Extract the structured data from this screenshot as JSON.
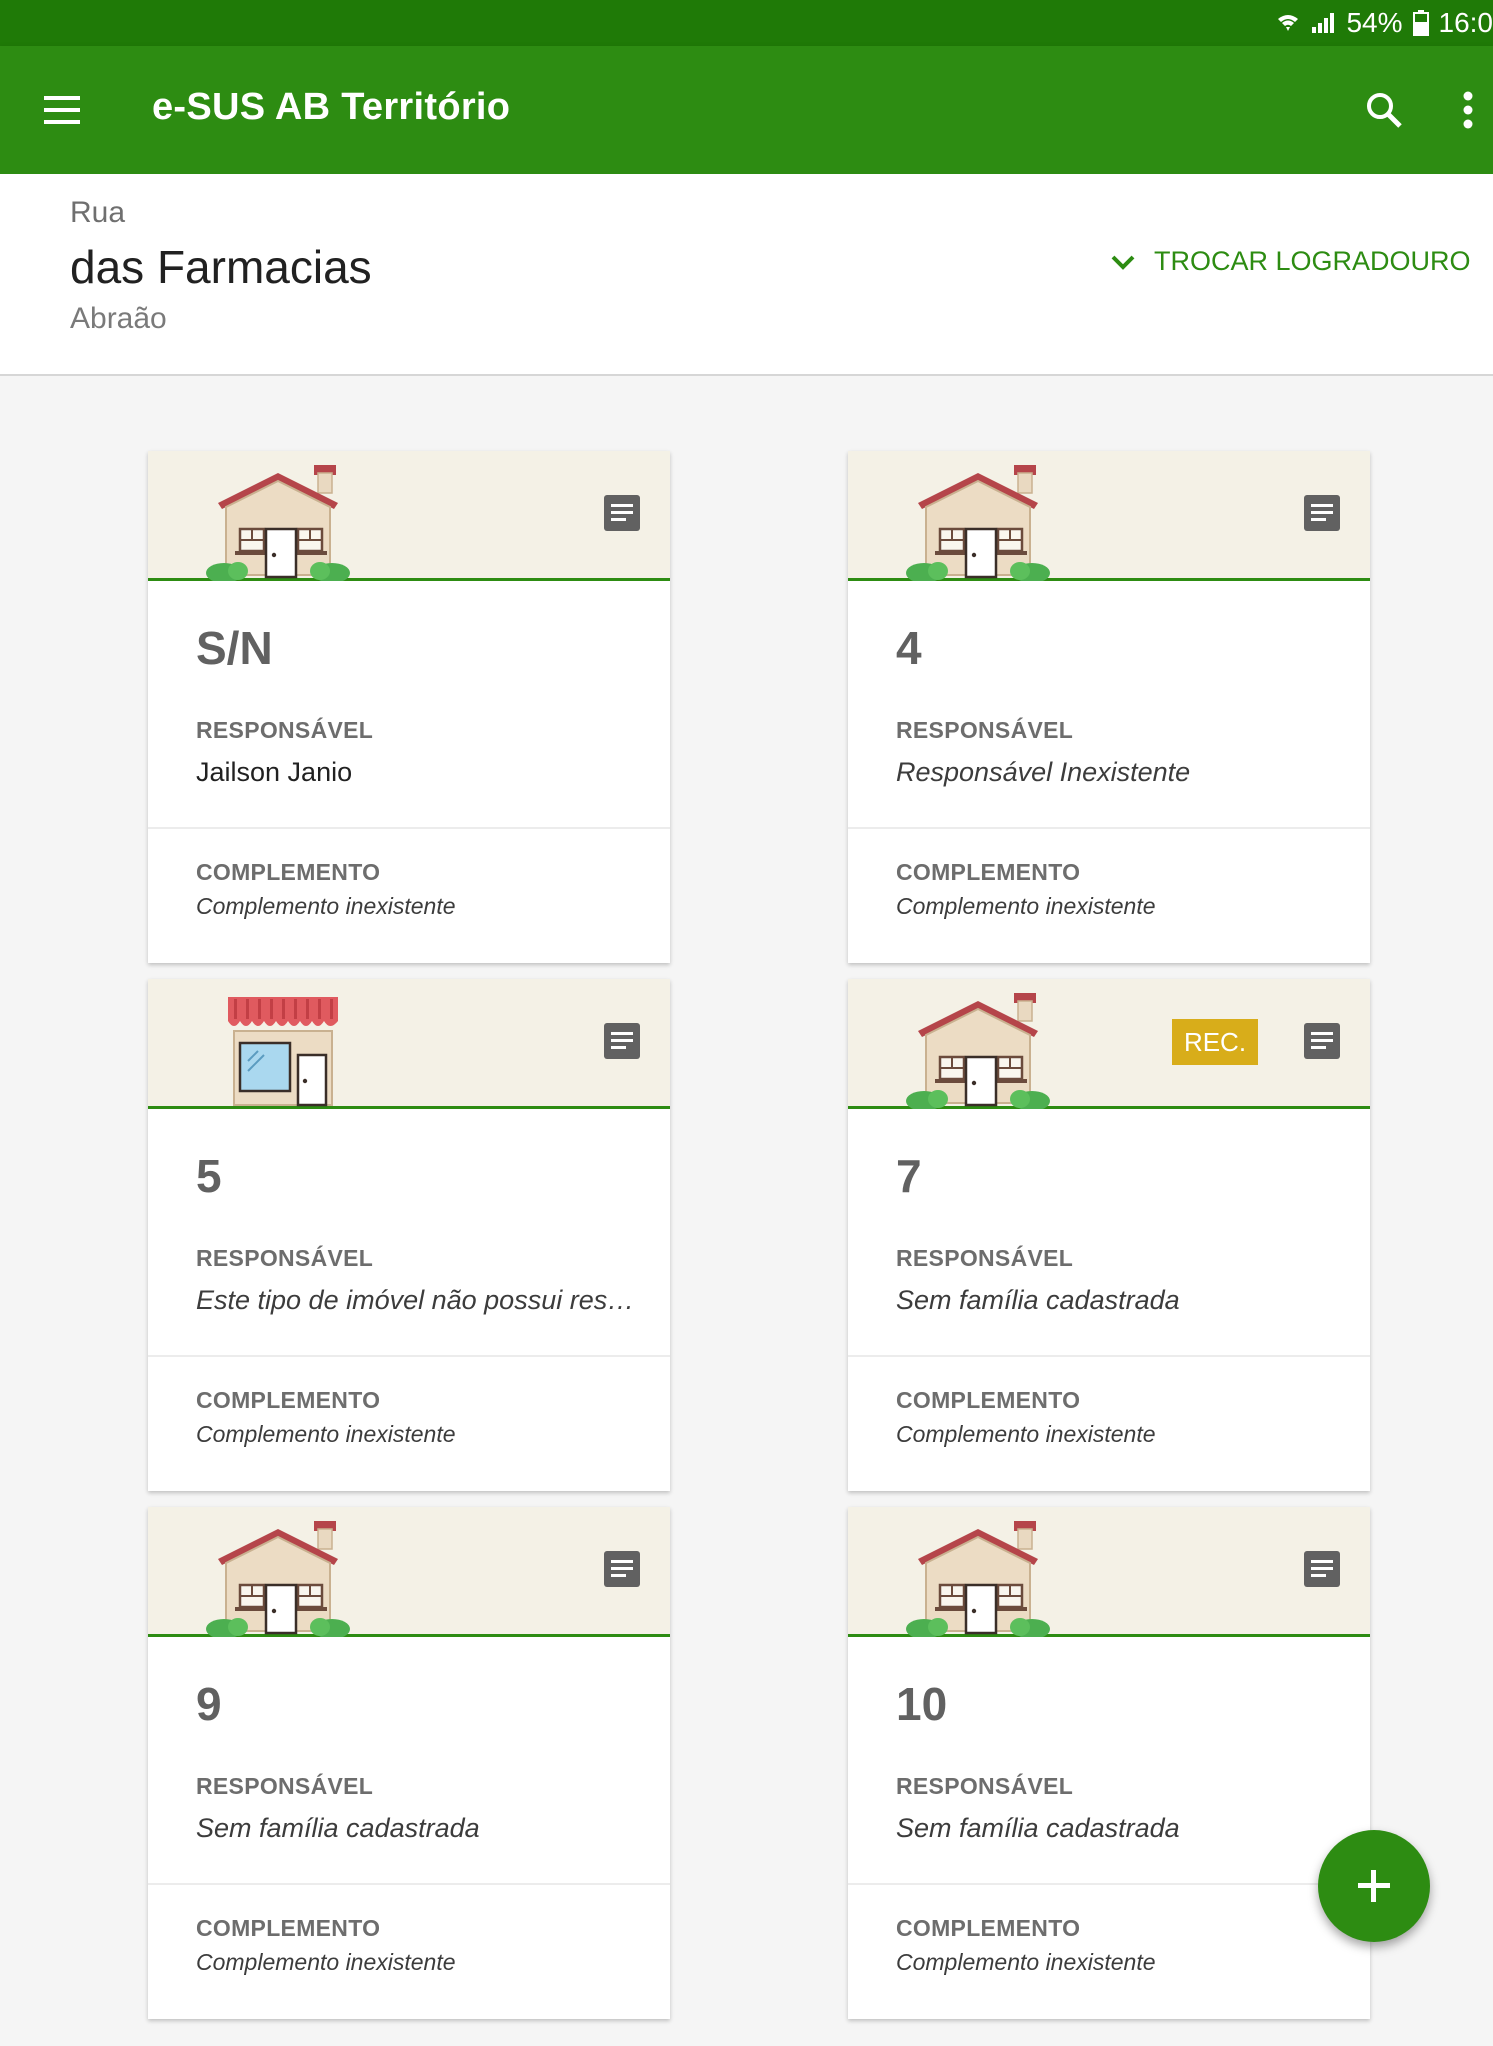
{
  "status_bar": {
    "battery": "54%",
    "time": "16:0"
  },
  "app_bar": {
    "title": "e-SUS AB Território"
  },
  "street": {
    "type": "Rua",
    "name": "das Farmacias",
    "area": "Abraão",
    "switch_label": "TROCAR LOGRADOURO"
  },
  "labels": {
    "responsavel": "RESPONSÁVEL",
    "complemento": "COMPLEMENTO"
  },
  "cards": [
    {
      "number": "S/N",
      "kind": "house",
      "responsavel": "Jailson Janio",
      "complemento": "Complemento inexistente"
    },
    {
      "number": "4",
      "kind": "house",
      "responsavel": "Responsável Inexistente",
      "complemento": "Complemento inexistente"
    },
    {
      "number": "5",
      "kind": "shop",
      "responsavel": "Este tipo de imóvel não possui responsável",
      "complemento": "Complemento inexistente"
    },
    {
      "number": "7",
      "kind": "house",
      "badge": "REC.",
      "responsavel": "Sem família cadastrada",
      "complemento": "Complemento inexistente"
    },
    {
      "number": "9",
      "kind": "house",
      "responsavel": "Sem família cadastrada",
      "complemento": "Complemento inexistente"
    },
    {
      "number": "10",
      "kind": "house",
      "responsavel": "Sem família cadastrada",
      "complemento": "Complemento inexistente"
    }
  ],
  "colors": {
    "primary": "#2d8c12",
    "status_bar": "#1f7a07",
    "badge": "#d8ad1a",
    "card_top": "#f4f1e6"
  }
}
